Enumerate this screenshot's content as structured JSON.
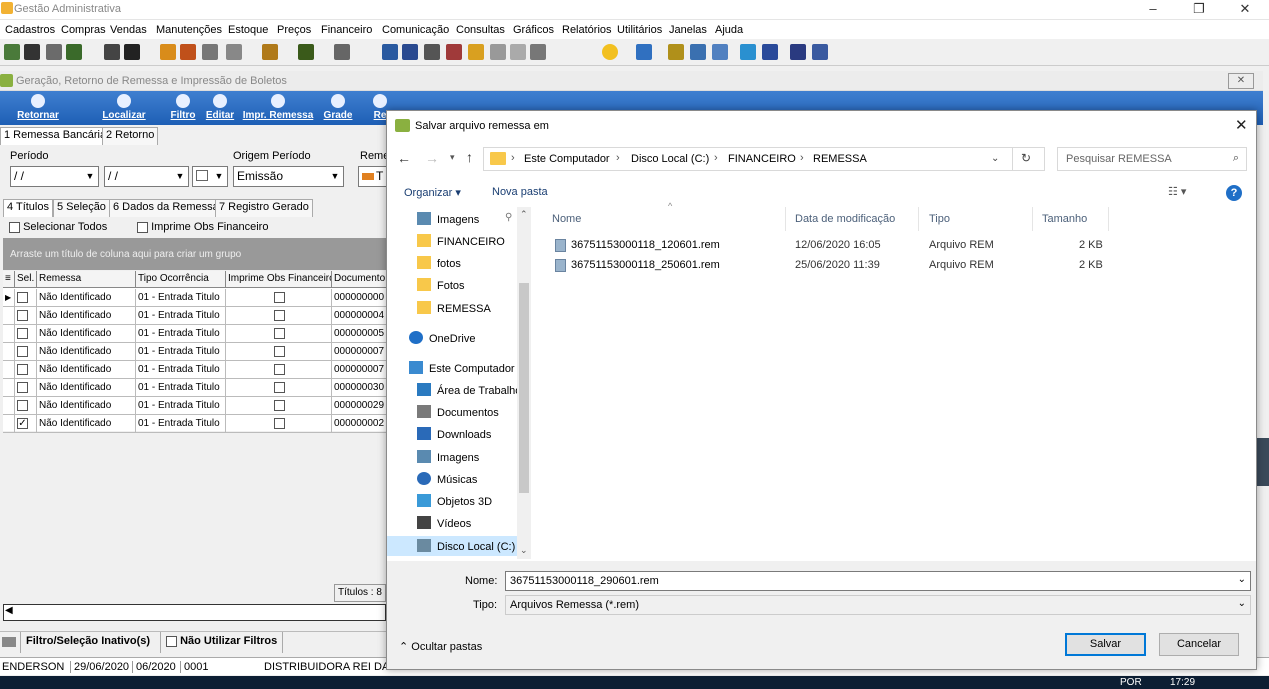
{
  "app": {
    "title": "Gestão Administrativa",
    "menu": [
      "Cadastros",
      "Compras",
      "Vendas",
      "Manutenções",
      "Estoque",
      "Preços",
      "Financeiro",
      "Comunicação",
      "Consultas",
      "Gráficos",
      "Relatórios",
      "Utilitários",
      "Janelas",
      "Ajuda"
    ],
    "window_controls": [
      "–",
      "❐",
      "✕"
    ]
  },
  "child": {
    "title": "Geração, Retorno de Remessa e Impressão de Boletos",
    "toolbar": [
      "Retornar",
      "Localizar",
      "Filtro",
      "Editar",
      "Impr. Remessa",
      "Grade",
      "Re"
    ],
    "tabs": [
      "1 Remessa Bancária",
      "2 Retorno"
    ],
    "labels": {
      "periodo": "Período",
      "origem": "Origem Período",
      "reme": "Reme"
    },
    "date1": "/ /",
    "date2": "/ /",
    "origem_value": "Emissão",
    "t_value": "T",
    "subtabs": [
      "4 Títulos",
      "5 Seleção",
      "6 Dados da Remessa",
      "7 Registro Gerado"
    ],
    "selecionar_todos": "Selecionar Todos",
    "imprime_obs": "Imprime Obs Financeiro",
    "group_hint": "Arraste um título de coluna aqui para criar um grupo",
    "columns": [
      "Sel.",
      "Remessa",
      "Tipo Ocorrência",
      "Imprime Obs Financeiro",
      "Documento"
    ],
    "rows": [
      {
        "checked": false,
        "remessa": "Não Identificado",
        "tipo": "01 - Entrada Titulo",
        "doc": "000000000"
      },
      {
        "checked": false,
        "remessa": "Não Identificado",
        "tipo": "01 - Entrada Titulo",
        "doc": "000000004"
      },
      {
        "checked": false,
        "remessa": "Não Identificado",
        "tipo": "01 - Entrada Titulo",
        "doc": "000000005"
      },
      {
        "checked": false,
        "remessa": "Não Identificado",
        "tipo": "01 - Entrada Titulo",
        "doc": "000000007"
      },
      {
        "checked": false,
        "remessa": "Não Identificado",
        "tipo": "01 - Entrada Titulo",
        "doc": "000000007"
      },
      {
        "checked": false,
        "remessa": "Não Identificado",
        "tipo": "01 - Entrada Titulo",
        "doc": "000000030"
      },
      {
        "checked": false,
        "remessa": "Não Identificado",
        "tipo": "01 - Entrada Titulo",
        "doc": "000000029"
      },
      {
        "checked": true,
        "remessa": "Não Identificado",
        "tipo": "01 - Entrada Titulo",
        "doc": "000000002"
      }
    ],
    "titulos_count": "Títulos : 8",
    "filtro_status": "Filtro/Seleção Inativo(s)",
    "nao_utilizar_filtros": "Não Utilizar Filtros"
  },
  "statusbar": [
    "ENDERSON",
    "29/06/2020",
    "06/2020",
    "0001",
    "DISTRIBUIDORA REI DA PALHA LTDA"
  ],
  "dialog": {
    "title": "Salvar arquivo remessa em",
    "breadcrumb": [
      "Este Computador",
      "Disco Local (C:)",
      "FINANCEIRO",
      "REMESSA"
    ],
    "search_placeholder": "Pesquisar REMESSA",
    "organizar": "Organizar ▾",
    "nova_pasta": "Nova pasta",
    "nav": [
      {
        "label": "Imagens",
        "icon": "images-icon"
      },
      {
        "label": "FINANCEIRO",
        "icon": "folder-icon"
      },
      {
        "label": "fotos",
        "icon": "folder-icon"
      },
      {
        "label": "Fotos",
        "icon": "folder-icon"
      },
      {
        "label": "REMESSA",
        "icon": "folder-icon"
      },
      {
        "label": "OneDrive",
        "icon": "onedrive-icon"
      },
      {
        "label": "Este Computador",
        "icon": "computer-icon"
      },
      {
        "label": "Área de Trabalho",
        "icon": "desktop-icon"
      },
      {
        "label": "Documentos",
        "icon": "documents-icon"
      },
      {
        "label": "Downloads",
        "icon": "downloads-icon"
      },
      {
        "label": "Imagens",
        "icon": "images-icon"
      },
      {
        "label": "Músicas",
        "icon": "music-icon"
      },
      {
        "label": "Objetos 3D",
        "icon": "objects3d-icon"
      },
      {
        "label": "Vídeos",
        "icon": "videos-icon"
      },
      {
        "label": "Disco Local (C:)",
        "icon": "drive-icon"
      }
    ],
    "columns": [
      "Nome",
      "Data de modificação",
      "Tipo",
      "Tamanho"
    ],
    "files": [
      {
        "name": "36751153000118_120601.rem",
        "date": "12/06/2020 16:05",
        "type": "Arquivo REM",
        "size": "2 KB"
      },
      {
        "name": "36751153000118_250601.rem",
        "date": "25/06/2020 11:39",
        "type": "Arquivo REM",
        "size": "2 KB"
      }
    ],
    "nome_label": "Nome:",
    "nome_value": "36751153000118_290601.rem",
    "tipo_label": "Tipo:",
    "tipo_value": "Arquivos Remessa (*.rem)",
    "ocultar": "Ocultar pastas",
    "salvar": "Salvar",
    "cancelar": "Cancelar"
  },
  "taskbar": {
    "lang": "POR",
    "time": "17:29"
  },
  "colors": {
    "accent": "#0078d7",
    "toolbar_blue": "#1e5fb5",
    "folder": "#f8c84a"
  }
}
